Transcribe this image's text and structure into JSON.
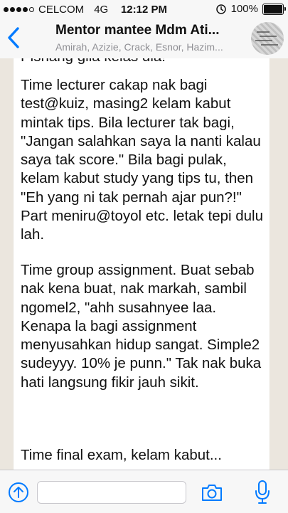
{
  "status": {
    "carrier": "CELCOM",
    "network": "4G",
    "time": "12:12 PM",
    "battery": "100%"
  },
  "header": {
    "title": "Mentor mantee Mdm Ati...",
    "subtitle": "Amirah, Azizie, Crack, Esnor, Hazim..."
  },
  "message": {
    "paragraphs": [
      "Pishang gila kelas dia!",
      "Time lecturer cakap nak bagi test@kuiz, masing2 kelam kabut mintak tips. Bila lecturer tak bagi, \"Jangan salahkan saya la nanti kalau saya tak score.\" Bila bagi pulak, kelam kabut study yang tips tu, then \"Eh yang ni tak pernah ajar pun?!\" Part meniru@toyol etc. letak tepi dulu lah.",
      "Time group assignment. Buat sebab nak kena buat, nak markah, sambil ngomel2, \"ahh susahnyee laa. Kenapa la bagi assignment menyusahkan hidup sangat. Simple2 sudeyyy. 10% je punn.\" Tak nak buka hati langsung fikir jauh sikit.",
      "Time final exam, kelam kabut..."
    ]
  },
  "input": {
    "placeholder": ""
  },
  "colors": {
    "accent": "#007aff",
    "chat_background": "#ebe6de",
    "bubble": "#ffffff"
  },
  "icons": [
    "back-chevron-icon",
    "share-icon",
    "camera-icon",
    "microphone-icon",
    "alarm-icon"
  ]
}
